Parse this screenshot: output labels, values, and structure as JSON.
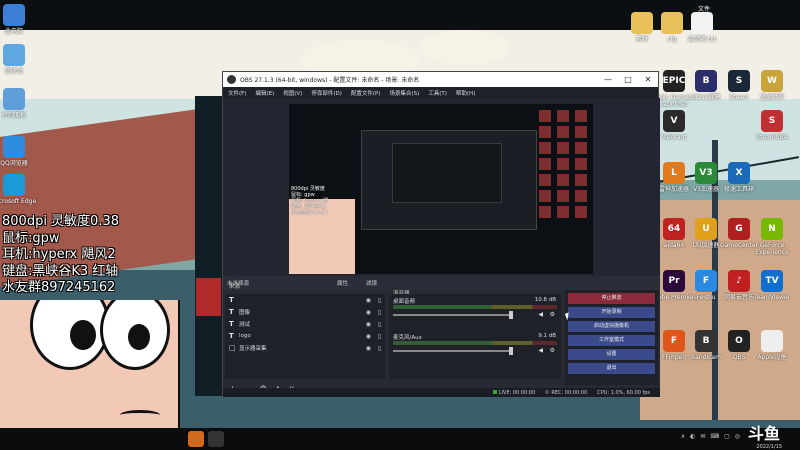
{
  "desktop_left_icons": [
    {
      "label": "此电脑",
      "color": "#3c7fd6"
    },
    {
      "label": "回收站",
      "color": "#5fa7e0"
    },
    {
      "label": "控制面板",
      "color": "#5f9fd9"
    },
    {
      "label": "QQ浏览器",
      "color": "#2f8de0"
    },
    {
      "label": "Microsoft Edge",
      "color": "#1a9ad6"
    }
  ],
  "desktop_right_top": {
    "header": "文件",
    "items": [
      {
        "label": "素材",
        "color": "#e8c15a"
      },
      {
        "label": "cfg",
        "color": "#e8c15a"
      },
      {
        "label": "启动项.txt",
        "color": "#f2f2f2"
      }
    ]
  },
  "desktop_right_icons": [
    {
      "label": "Epic Games Launcher",
      "color": "#222222",
      "glyph": "EPIC"
    },
    {
      "label": "BOSS直聘",
      "color": "#2a2f6b",
      "glyph": "B"
    },
    {
      "label": "Steam",
      "color": "#1b2838",
      "glyph": "S"
    },
    {
      "label": "完美世界",
      "color": "#c9a43a",
      "glyph": "W"
    },
    {
      "label": "Valorant",
      "color": "#2a2a2a",
      "glyph": "V"
    },
    {
      "label": "雷神加速器",
      "color": "#e07a1a",
      "glyph": "L"
    },
    {
      "label": "V3加速器",
      "color": "#2a8a3a",
      "glyph": "V3"
    },
    {
      "label": "极速工具箱",
      "color": "#1a6ab8",
      "glyph": "X"
    },
    {
      "label": "SteamSBA",
      "color": "#c03030",
      "glyph": "S"
    },
    {
      "label": "aida64",
      "color": "#c02222",
      "glyph": "64"
    },
    {
      "label": "UU加速器",
      "color": "#e0a01a",
      "glyph": "U"
    },
    {
      "label": "GameCenter",
      "color": "#b02020",
      "glyph": "G"
    },
    {
      "label": "GeForce Experience",
      "color": "#76b900",
      "glyph": "N"
    },
    {
      "label": "Adobe Premiere",
      "color": "#2a0a3a",
      "glyph": "Pr"
    },
    {
      "label": "Feishu",
      "color": "#2a8ae0",
      "glyph": "F"
    },
    {
      "label": "网易云音乐",
      "color": "#c02020",
      "glyph": "♪"
    },
    {
      "label": "TeamViewer",
      "color": "#0e6fd0",
      "glyph": "TV"
    },
    {
      "label": "FFmpeg",
      "color": "#e0551a",
      "glyph": "F"
    },
    {
      "label": "Bandicam",
      "color": "#333333",
      "glyph": "B"
    },
    {
      "label": "OBS",
      "color": "#222222",
      "glyph": "O"
    },
    {
      "label": "Apple设备",
      "color": "#eeeeee",
      "glyph": ""
    }
  ],
  "streamer_specs": [
    "800dpi 灵敏度0.38",
    "鼠标:gpw",
    "耳机:hyperx 飓风2",
    "键盘:黑峡谷K3 红轴",
    "水友群897245162"
  ],
  "obs": {
    "title": "OBS 27.1.3 (64-bit, windows) - 配置文件: 未命名 - 场景: 未命名",
    "menu": [
      "文件(F)",
      "编辑(E)",
      "视图(V)",
      "停靠部件(D)",
      "配置文件(P)",
      "场景集合(S)",
      "工具(T)",
      "帮助(H)"
    ],
    "scene_bar": [
      "未选择源",
      "属性",
      "滤镜"
    ],
    "sources_title": "来源",
    "sources": [
      {
        "type": "T",
        "label": ""
      },
      {
        "type": "T",
        "label": "图像"
      },
      {
        "type": "T",
        "label": "测试"
      },
      {
        "type": "T",
        "label": "logo"
      },
      {
        "type": "□",
        "label": "显示器采集"
      }
    ],
    "mixer_title": "混音器",
    "mixer": [
      {
        "label": "桌面音频",
        "db": "10.8 dB"
      },
      {
        "label": "麦克风/Aux",
        "db": "9.1 dB"
      }
    ],
    "controls_title": "控件",
    "controls": [
      "停止推流",
      "开始录制",
      "启动虚拟摄像机",
      "工作室模式",
      "设置",
      "退出"
    ],
    "status": {
      "live": "LIVE: 00:00:00",
      "rec": "REC: 00:00:00",
      "cpu": "CPU: 1.0%, 60.00 fps"
    },
    "preview_text": [
      "800dpi 灵敏度",
      "鼠标: gpw",
      "耳机: hyperx 飓",
      "键盘: 黑峡谷K3",
      "水友群8972451"
    ]
  },
  "taskbar": {
    "tray": [
      "∧",
      "◐",
      "✉",
      "⌨",
      "▢",
      "◎"
    ],
    "watermark": "斗鱼",
    "date": "2022/1/15"
  }
}
